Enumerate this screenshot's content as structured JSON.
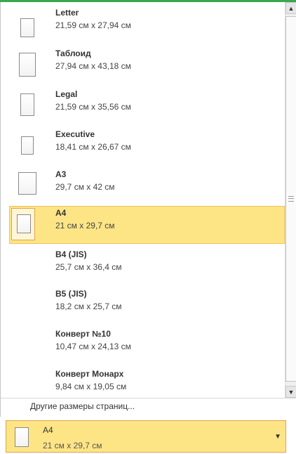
{
  "items": [
    {
      "name": "Letter",
      "dims": "21,59 см x 27,94 см"
    },
    {
      "name": "Таблоид",
      "dims": "27,94 см x 43,18 см"
    },
    {
      "name": "Legal",
      "dims": "21,59 см x 35,56 см"
    },
    {
      "name": "Executive",
      "dims": "18,41 см x 26,67 см"
    },
    {
      "name": "A3",
      "dims": "29,7 см x 42 см"
    },
    {
      "name": "A4",
      "dims": "21 см x 29,7 см"
    },
    {
      "name": "B4 (JIS)",
      "dims": "25,7 см x 36,4 см"
    },
    {
      "name": "B5 (JIS)",
      "dims": "18,2 см x 25,7 см"
    },
    {
      "name": "Конверт №10",
      "dims": "10,47 см x 24,13 см"
    },
    {
      "name": "Конверт Монарх",
      "dims": "9,84 см x 19,05 см"
    }
  ],
  "selected_index": 5,
  "more_sizes_label": "Другие размеры страниц...",
  "current": {
    "name": "A4",
    "dims": "21 см x 29,7 см"
  },
  "icons": {
    "page": "page-icon",
    "scroll_up": "scroll-up-arrow-icon",
    "scroll_down": "scroll-down-arrow-icon",
    "dropdown": "chevron-down-icon"
  },
  "colors": {
    "selection": "#fde586",
    "selection_border": "#e3a34c",
    "top_accent": "#3aa651"
  }
}
